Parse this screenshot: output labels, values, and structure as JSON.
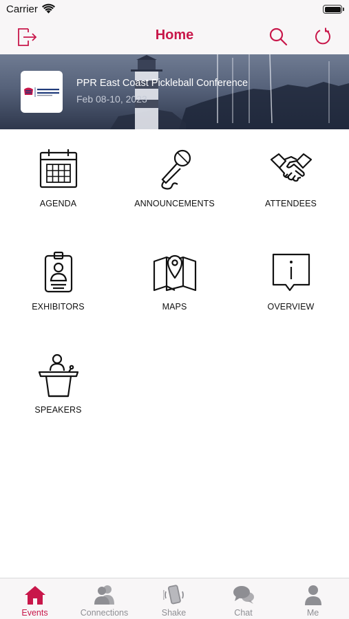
{
  "status_bar": {
    "carrier": "Carrier"
  },
  "nav": {
    "title": "Home"
  },
  "event": {
    "title": "PPR East Coast Pickleball Conference",
    "date": "Feb 08-10, 2023",
    "logo_text": "PICKLEBALL CONFERENCE",
    "logo_mark": "PPR"
  },
  "modules": [
    {
      "label": "AGENDA",
      "icon": "calendar-icon"
    },
    {
      "label": "ANNOUNCEMENTS",
      "icon": "microphone-icon"
    },
    {
      "label": "ATTENDEES",
      "icon": "handshake-icon"
    },
    {
      "label": "EXHIBITORS",
      "icon": "id-badge-icon"
    },
    {
      "label": "MAPS",
      "icon": "map-icon"
    },
    {
      "label": "OVERVIEW",
      "icon": "info-icon"
    },
    {
      "label": "SPEAKERS",
      "icon": "podium-icon"
    }
  ],
  "tabs": [
    {
      "label": "Events",
      "icon": "home-icon",
      "active": true
    },
    {
      "label": "Connections",
      "icon": "people-icon",
      "active": false
    },
    {
      "label": "Shake",
      "icon": "phone-shake-icon",
      "active": false
    },
    {
      "label": "Chat",
      "icon": "chat-bubbles-icon",
      "active": false
    },
    {
      "label": "Me",
      "icon": "person-icon",
      "active": false
    }
  ],
  "colors": {
    "accent": "#c8174a",
    "inactive": "#8e8e93",
    "bar_bg": "#f8f6f7"
  }
}
